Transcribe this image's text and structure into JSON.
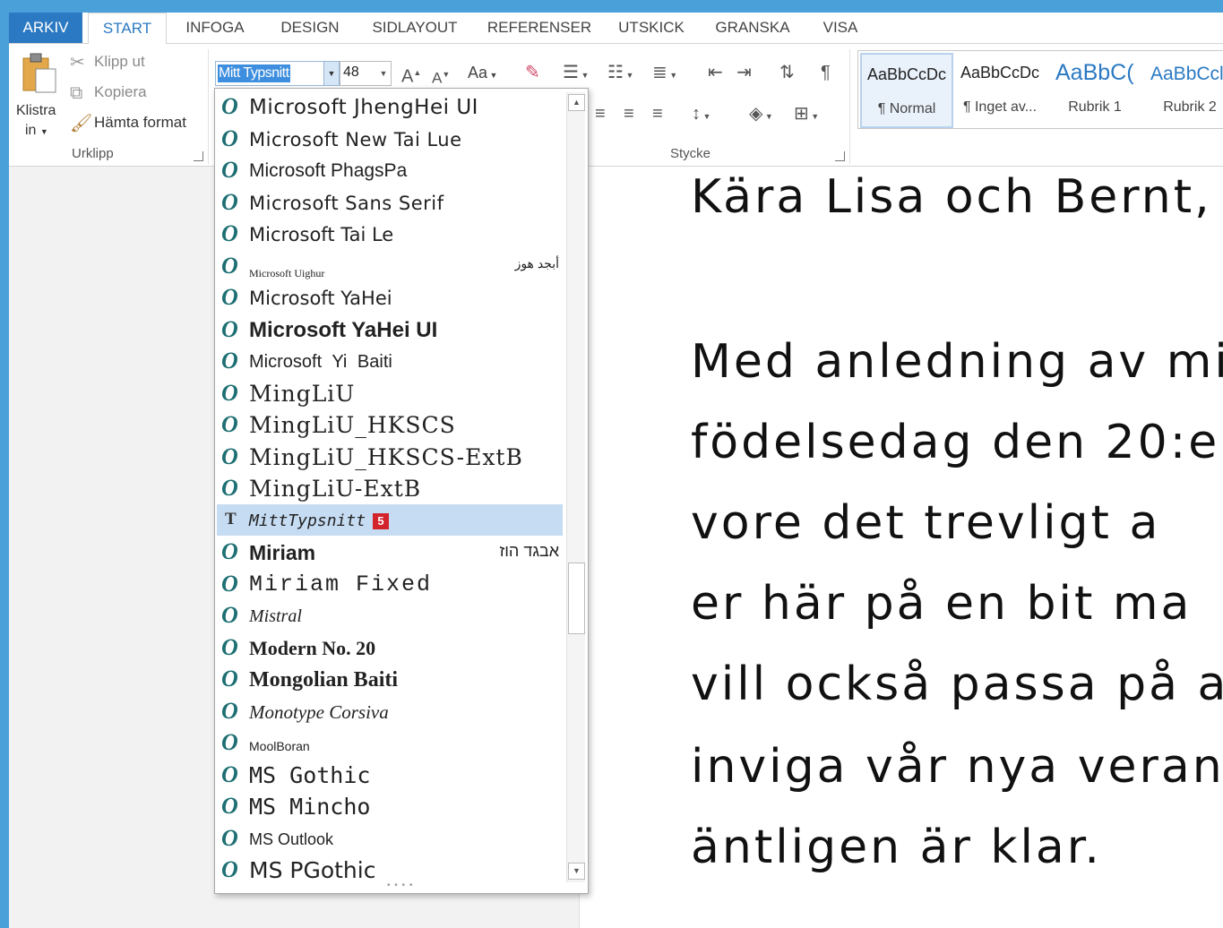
{
  "tabs": [
    "ARKIV",
    "START",
    "INFOGA",
    "DESIGN",
    "SIDLAYOUT",
    "REFERENSER",
    "UTSKICK",
    "GRANSKA",
    "VISA"
  ],
  "clipboard": {
    "paste_label_1": "Klistra",
    "paste_label_2": "in",
    "cut": "Klipp ut",
    "copy": "Kopiera",
    "format_painter": "Hämta format",
    "group_label": "Urklipp"
  },
  "font": {
    "name": "Mitt Typsnitt",
    "size": "48",
    "change_case": "Aa"
  },
  "paragraph": {
    "group_label": "Stycke"
  },
  "styles": {
    "items": [
      {
        "preview": "AaBbCcDc",
        "name": "¶ Normal"
      },
      {
        "preview": "AaBbCcDc",
        "name": "¶ Inget av..."
      },
      {
        "preview": "AaBbC(",
        "name": "Rubrik 1"
      },
      {
        "preview": "AaBbCcl",
        "name": "Rubrik 2"
      }
    ],
    "accent": "#2b79c2"
  },
  "font_list": {
    "items": [
      {
        "name": "Microsoft JhengHei UI",
        "type": "O",
        "sample": ""
      },
      {
        "name": "Microsoft New Tai Lue",
        "type": "O",
        "sample": ""
      },
      {
        "name": "Microsoft PhagsPa",
        "type": "O",
        "sample": ""
      },
      {
        "name": "Microsoft Sans Serif",
        "type": "O",
        "sample": ""
      },
      {
        "name": "Microsoft Tai Le",
        "type": "O",
        "sample": ""
      },
      {
        "name": "Microsoft Uighur",
        "type": "O",
        "sample": "أبجد هوز"
      },
      {
        "name": "Microsoft YaHei",
        "type": "O",
        "sample": ""
      },
      {
        "name": "Microsoft YaHei UI",
        "type": "O",
        "sample": ""
      },
      {
        "name": "Microsoft Yi Baiti",
        "type": "O",
        "sample": ""
      },
      {
        "name": "MingLiU",
        "type": "O",
        "sample": ""
      },
      {
        "name": "MingLiU_HKSCS",
        "type": "O",
        "sample": ""
      },
      {
        "name": "MingLiU_HKSCS-ExtB",
        "type": "O",
        "sample": ""
      },
      {
        "name": "MingLiU-ExtB",
        "type": "O",
        "sample": ""
      },
      {
        "name": "MittTypsnitt",
        "type": "T",
        "sample": "",
        "badge": "5"
      },
      {
        "name": "Miriam",
        "type": "O",
        "sample": "אבגד הוז"
      },
      {
        "name": "Miriam Fixed",
        "type": "O",
        "sample": ""
      },
      {
        "name": "Mistral",
        "type": "O",
        "sample": ""
      },
      {
        "name": "Modern No. 20",
        "type": "O",
        "sample": ""
      },
      {
        "name": "Mongolian Baiti",
        "type": "O",
        "sample": ""
      },
      {
        "name": "Monotype Corsiva",
        "type": "O",
        "sample": ""
      },
      {
        "name": "MoolBoran",
        "type": "O",
        "sample": ""
      },
      {
        "name": "MS Gothic",
        "type": "O",
        "sample": ""
      },
      {
        "name": "MS Mincho",
        "type": "O",
        "sample": ""
      },
      {
        "name": "MS Outlook",
        "type": "O",
        "sample": ""
      },
      {
        "name": "MS PGothic",
        "type": "O",
        "sample": ""
      }
    ]
  },
  "document": {
    "lines": [
      "Kära Lisa och Bernt,",
      "",
      "Med anledning av mi",
      "födelsedag den 20:e",
      "vore det trevligt a",
      "er här på en bit ma",
      "vill också passa på a",
      "inviga vår nya verand",
      "äntligen är klar."
    ]
  }
}
